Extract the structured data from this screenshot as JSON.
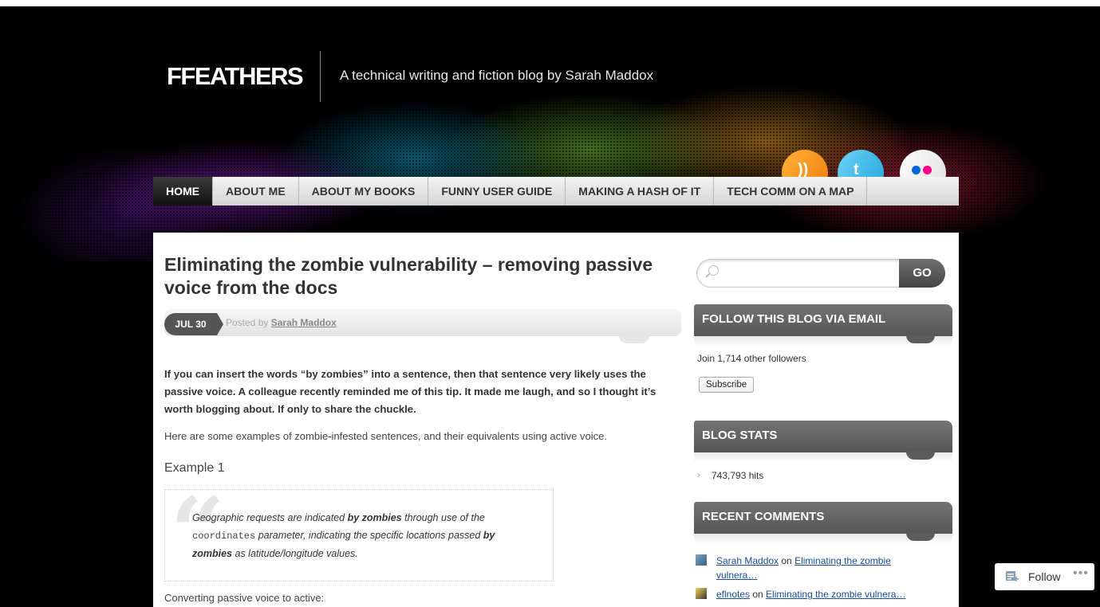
{
  "site": {
    "title": "FFEATHERS",
    "description": "A technical writing and fiction blog by Sarah Maddox"
  },
  "social": {
    "icons": [
      "rss-icon",
      "twitter-icon",
      "flickr-icon"
    ]
  },
  "nav": {
    "items": [
      "HOME",
      "ABOUT ME",
      "ABOUT MY BOOKS",
      "FUNNY USER GUIDE",
      "MAKING A HASH OF IT",
      "TECH COMM ON A MAP"
    ],
    "active": "HOME"
  },
  "post": {
    "title": "Eliminating the zombie vulnerability – removing passive voice from the docs",
    "date": "JUL 30",
    "posted_by": "Posted by",
    "author": "Sarah Maddox",
    "intro": "If you can insert the words “by zombies” into a sentence, then that sentence very likely uses the passive voice. A colleague recently reminded me of this tip. It made me laugh, and so I thought it’s worth blogging about. If only to share the chuckle.",
    "para": "Here are some examples of zombie-infested sentences, and their equivalents using active voice.",
    "example_heading": "Example 1",
    "quote": {
      "mark": "“",
      "t1": "Geographic requests are indicated ",
      "b1": "by zombies",
      "t2": " through use of the ",
      "code": "coordinates",
      "t3": " parameter, indicating the specific locations passed ",
      "b2": "by zombies",
      "t4": " as latitude/longitude values."
    },
    "cut_text": "Converting passive voice to active:"
  },
  "sidebar": {
    "search": {
      "placeholder": "",
      "button": "GO"
    },
    "follow_email": {
      "heading": "FOLLOW THIS BLOG VIA EMAIL",
      "followers": "Join 1,714 other followers",
      "subscribe": "Subscribe"
    },
    "stats": {
      "heading": "BLOG STATS",
      "hits": "743,793 hits"
    },
    "recent_comments": {
      "heading": "RECENT COMMENTS",
      "items": [
        {
          "author": "Sarah Maddox",
          "on": " on ",
          "post": "Eliminating the zombie vulnera…"
        },
        {
          "author": "eflnotes",
          "on": " on ",
          "post": "Eliminating the zombie vulnera…"
        }
      ]
    }
  },
  "follow": {
    "label": "Follow",
    "more": "•••"
  },
  "colors": {
    "nav_active": "#222222",
    "widget_head": "#5c5c5c",
    "link": "#1a4e94",
    "rss": "#f7931e",
    "twitter": "#33b6e9"
  }
}
